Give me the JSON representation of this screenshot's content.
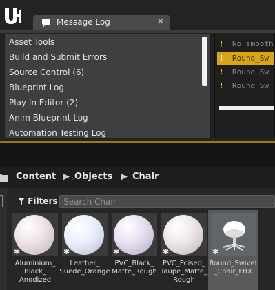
{
  "colors": {
    "accent_gold": "#d9a514",
    "warning_yellow": "#ffc400",
    "bar_green": "#27b02c",
    "bar_blue": "#3fb8d9",
    "panel_bg": "#3f3f3f"
  },
  "window": {
    "logo_icon": "unreal-logo-icon",
    "tab": {
      "title": "Message Log",
      "icon": "message-log-icon",
      "close_glyph": "×"
    }
  },
  "categories": [
    "Asset Tools",
    "Build and Submit Errors",
    "Source Control (6)",
    "Blueprint Log",
    "Play In Editor (2)",
    "Anim Blueprint Log",
    "Automation Testing Log"
  ],
  "messages": [
    {
      "icon": "warning-icon",
      "text": "No smooth",
      "selected": false
    },
    {
      "icon": "warning-icon",
      "text": "Round_Sw",
      "selected": true
    },
    {
      "icon": "warning-icon",
      "text": "Round_Sw",
      "selected": false
    },
    {
      "icon": "warning-icon",
      "text": "Round_Sw",
      "selected": false
    }
  ],
  "breadcrumb": [
    "Content",
    "Objects",
    "Chair"
  ],
  "breadcrumb_separator": "▶",
  "toolbar": {
    "filters_label": "Filters",
    "search_placeholder": "Search Chair",
    "search_value": ""
  },
  "assets": [
    {
      "label": "Aluminium_ Black_ Anodized",
      "color": "#ece0e6",
      "bar": "green",
      "selected": false
    },
    {
      "label": "Leather_ Suede_Orange",
      "color": "#e8eefb",
      "bar": "green",
      "selected": false
    },
    {
      "label": "PVC_Black_ Matte_Rough",
      "color": "#e6def0",
      "bar": "green",
      "selected": false
    },
    {
      "label": "PVC_Poised_ Taupe_Matte_ Rough",
      "color": "#ece5e6",
      "bar": "green",
      "selected": false
    },
    {
      "label": "Round_Swivel _Chair_FBX",
      "color": "#ffffff",
      "bar": "blue",
      "selected": true
    }
  ]
}
